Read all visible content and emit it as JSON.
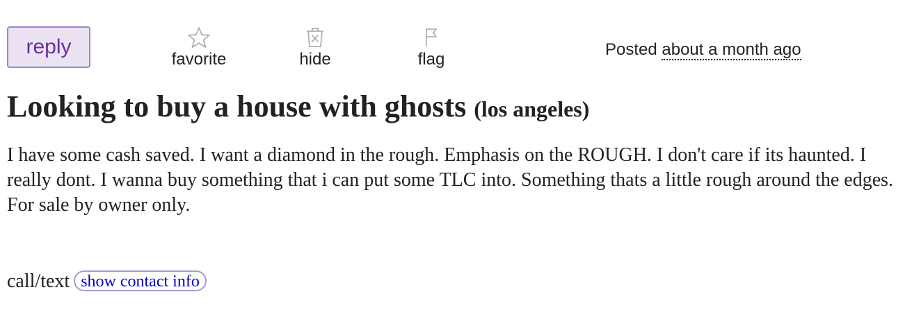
{
  "toolbar": {
    "reply_label": "reply",
    "favorite": {
      "label": "favorite",
      "icon": "star-icon"
    },
    "hide": {
      "label": "hide",
      "icon": "trash-x-icon"
    },
    "flag": {
      "label": "flag",
      "icon": "flag-icon"
    },
    "posted_prefix": "Posted",
    "posted_time": "about a month ago"
  },
  "post": {
    "title": "Looking to buy a house with ghosts",
    "location": "(los angeles)",
    "body": "I have some cash saved. I want a diamond in the rough. Emphasis on the ROUGH. I don't care if its haunted. I really dont. I wanna buy something that i can put some TLC into. Something thats a little rough around the edges. For sale by owner only."
  },
  "contact": {
    "prefix": "call/text",
    "button_label": "show contact info"
  },
  "colors": {
    "reply_bg": "#ebe3f1",
    "reply_border": "#9b86c8",
    "reply_text": "#6a2ca0",
    "link_blue": "#0000cc",
    "icon_gray": "#b0b0b0"
  }
}
